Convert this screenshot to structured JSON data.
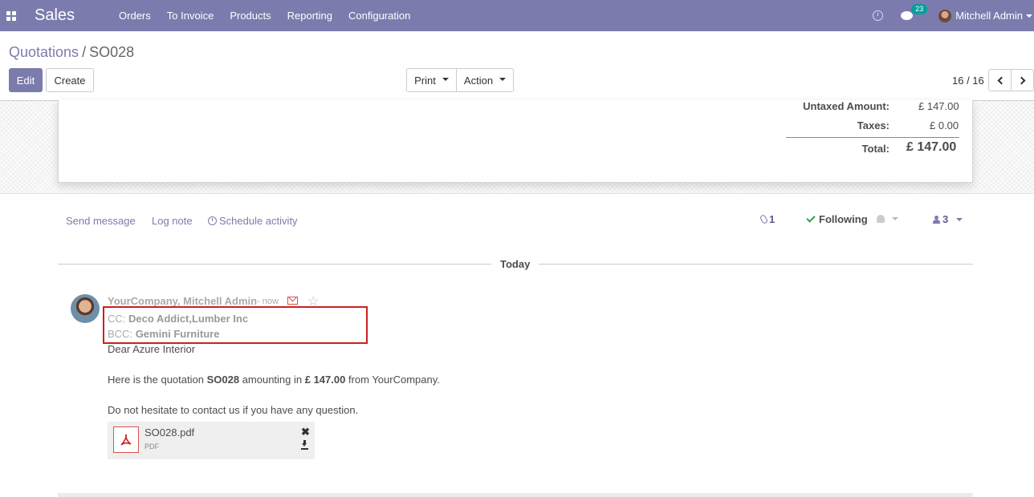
{
  "navbar": {
    "brand": "Sales",
    "menu": [
      "Orders",
      "To Invoice",
      "Products",
      "Reporting",
      "Configuration"
    ],
    "chat_count": "23",
    "user_name": "Mitchell Admin"
  },
  "breadcrumb": {
    "parent": "Quotations",
    "separator": "/",
    "current": "SO028"
  },
  "buttons": {
    "edit": "Edit",
    "create": "Create",
    "print": "Print",
    "action": "Action"
  },
  "pager": {
    "value": "16 / 16"
  },
  "totals": {
    "untaxed_label": "Untaxed Amount:",
    "untaxed_value": "£ 147.00",
    "taxes_label": "Taxes:",
    "taxes_value": "£ 0.00",
    "total_label": "Total:",
    "total_value": "£ 147.00"
  },
  "chatter": {
    "send_message": "Send message",
    "log_note": "Log note",
    "schedule_activity": "Schedule activity",
    "attachments_count": "1",
    "following": "Following",
    "followers_count": "3",
    "today": "Today"
  },
  "message": {
    "author": "YourCompany, Mitchell Admin",
    "date": "- now",
    "cc_label": "CC:",
    "cc_value": "Deco Addict,Lumber Inc",
    "bcc_label": "BCC:",
    "bcc_value": "Gemini Furniture",
    "greeting": "Dear Azure Interior",
    "line2_a": "Here is the quotation ",
    "line2_b": "SO028",
    "line2_c": " amounting in ",
    "line2_d": "£ 147.00",
    "line2_e": " from YourCompany.",
    "line3": "Do not hesitate to contact us if you have any question.",
    "attachment_name": "SO028.pdf",
    "attachment_ext": "PDF"
  },
  "colors": {
    "brand": "#7c7bad",
    "highlight_box": "#c9211e",
    "following_check": "#28a745"
  },
  "icons": [
    "apps-icon",
    "clock-icon",
    "chat-icon",
    "paperclip-icon",
    "check-icon",
    "bell-icon",
    "user-icon",
    "envelope-icon",
    "star-icon",
    "pdf-icon",
    "remove-icon",
    "download-icon"
  ]
}
